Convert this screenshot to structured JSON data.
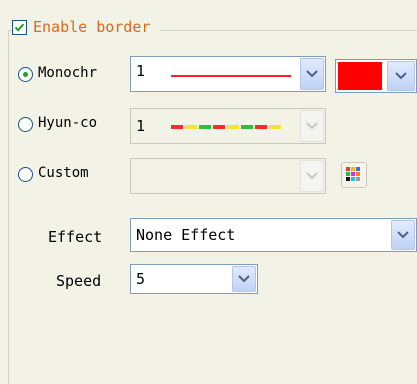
{
  "border_group": {
    "enable_label": "Enable border",
    "enabled": true
  },
  "modes": [
    {
      "label": "Monochr",
      "selected": true,
      "value": "1"
    },
    {
      "label": "Hyun-co",
      "selected": false,
      "value": "1"
    },
    {
      "label": "Custom",
      "selected": false,
      "value": ""
    }
  ],
  "monochrome": {
    "color": "#ff0000",
    "line_color": "#ff2020"
  },
  "effect": {
    "label": "Effect",
    "value": "None Effect"
  },
  "speed": {
    "label": "Speed",
    "value": "5"
  },
  "icons": {
    "checkbox": "check-icon",
    "dropdown": "chevron-down-icon",
    "palette": "color-palette-icon"
  }
}
